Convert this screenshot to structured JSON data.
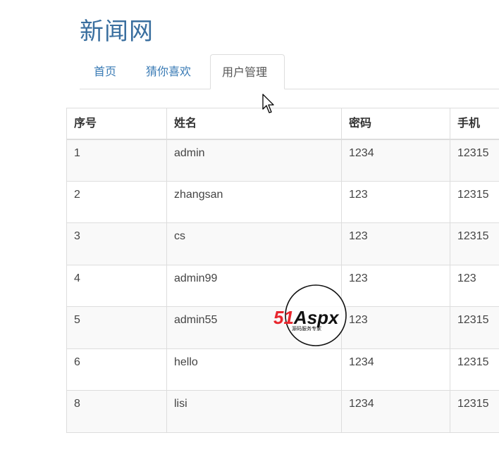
{
  "site": {
    "title": "新闻网"
  },
  "nav": {
    "tabs": [
      {
        "label": "首页"
      },
      {
        "label": "猜你喜欢"
      },
      {
        "label": "用户管理"
      }
    ]
  },
  "table": {
    "headers": [
      "序号",
      "姓名",
      "密码",
      "手机"
    ],
    "rows": [
      [
        "1",
        "admin",
        "1234",
        "12315"
      ],
      [
        "2",
        "zhangsan",
        "123",
        "12315"
      ],
      [
        "3",
        "cs",
        "123",
        "12315"
      ],
      [
        "4",
        "admin99",
        "123",
        "123"
      ],
      [
        "5",
        "admin55",
        "123",
        "12315"
      ],
      [
        "6",
        "hello",
        "1234",
        "12315"
      ],
      [
        "8",
        "lisi",
        "1234",
        "12315"
      ]
    ]
  },
  "watermark": {
    "brand": "51Aspx",
    "slogan": "源码服务专家",
    "brand_color": "#e8262d",
    "accent_color": "#2ea44f"
  },
  "colors": {
    "title": "#3a6f9f",
    "link": "#3a7bb5",
    "border": "#dddddd"
  }
}
